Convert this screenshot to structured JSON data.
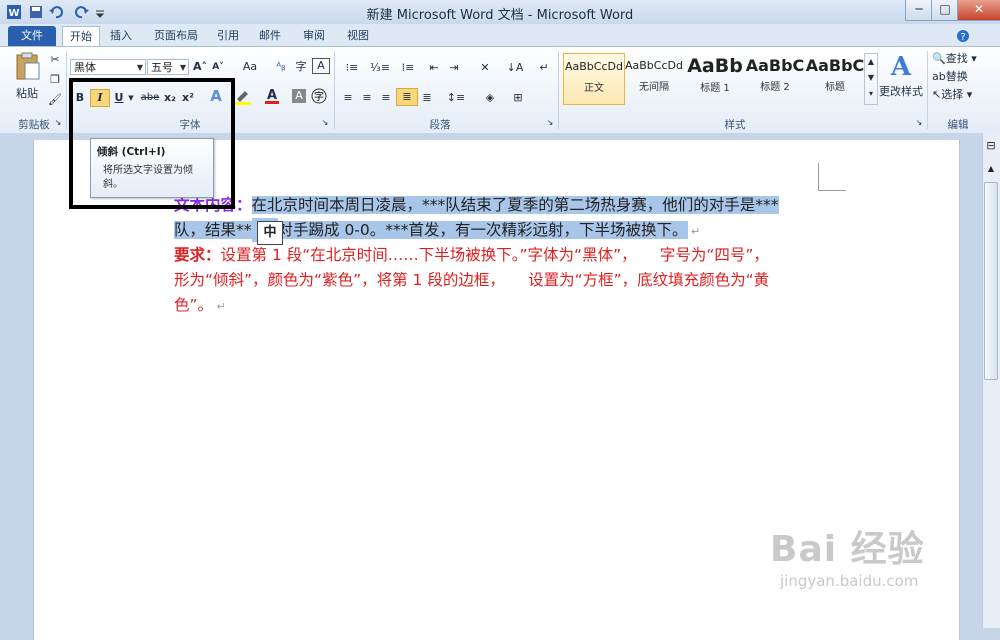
{
  "window": {
    "title": "新建 Microsoft Word 文档 - Microsoft Word",
    "controls": [
      "─",
      "□",
      "✕"
    ]
  },
  "tabs": [
    "文件",
    "开始",
    "插入",
    "页面布局",
    "引用",
    "邮件",
    "审阅",
    "视图"
  ],
  "clipboard": {
    "paste": "粘贴",
    "group": "剪贴板"
  },
  "font": {
    "name": "黑体",
    "size": "五号",
    "grow": "A˄",
    "shrink": "A˅",
    "case": "Aa",
    "bold": "B",
    "italic": "I",
    "underline": "U",
    "strike": "abe",
    "subscript": "x₂",
    "superscript": "x²",
    "group": "字体"
  },
  "paragraph": {
    "group": "段落"
  },
  "styles": {
    "items": [
      {
        "sample": "AaBbCcDd",
        "name": "正文"
      },
      {
        "sample": "AaBbCcDd",
        "name": "无间隔"
      },
      {
        "sample": "AaBb",
        "name": "标题 1"
      },
      {
        "sample": "AaBbC",
        "name": "标题 2"
      },
      {
        "sample": "AaBbC",
        "name": "标题"
      }
    ],
    "change": "更改样式",
    "group": "样式"
  },
  "editing": {
    "find": "查找",
    "replace": "替换",
    "select": "选择",
    "group": "编辑"
  },
  "tooltip": {
    "title": "倾斜 (Ctrl+I)",
    "body": "将所选文字设置为倾斜。"
  },
  "document": {
    "label": "文本内容：",
    "line1": "在北京时间本周日凌晨，***队结束了夏季的第二场热身赛，他们的对手是***",
    "line2a": "队，结果**",
    "ime": "中",
    "line2b": "对手踢成 0-0。***首发，有一次精彩远射，下半场被换下。",
    "req_label": "要求：",
    "req1": "设置第 1 段“在北京时间……下半场被换下。”字体为“黑体”，　　字号为“四号”，",
    "req2": "形为“倾斜”，颜色为“紫色”，将第 1 段的边框，　　设置为“方框”，底纹填充颜色为“黄",
    "req3": "色”。"
  },
  "watermark": {
    "brand": "Bai 经验",
    "url": "jingyan.baidu.com"
  }
}
